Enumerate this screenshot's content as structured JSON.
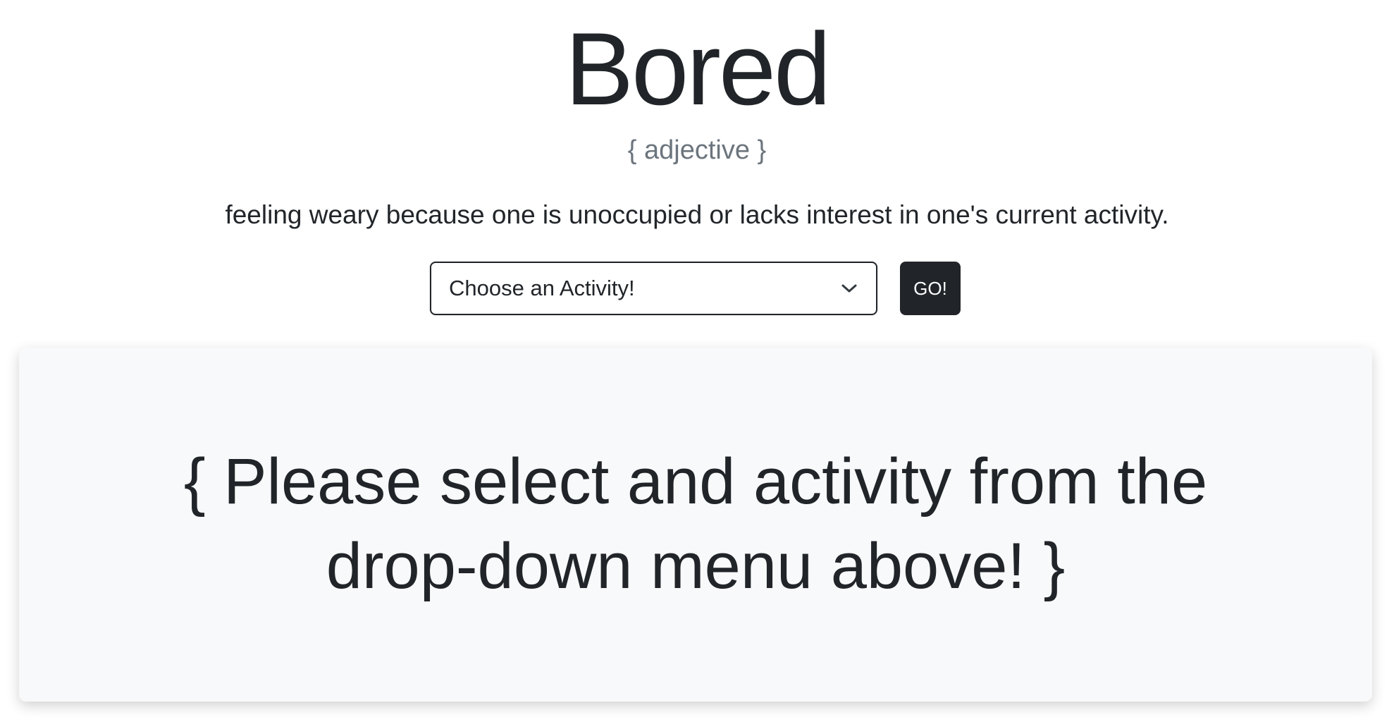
{
  "header": {
    "title": "Bored",
    "part_of_speech": "{ adjective }",
    "definition": "feeling weary because one is unoccupied or lacks interest in one's current activity."
  },
  "controls": {
    "activity_select": {
      "selected_label": "Choose an Activity!",
      "icon": "chevron-down-icon"
    },
    "go_label": "GO!"
  },
  "result_card": {
    "message": "{ Please select and activity from the drop-down menu above! }"
  },
  "colors": {
    "text": "#212529",
    "muted": "#6c757d",
    "card_bg": "#f8f9fa",
    "button_bg": "#212529"
  }
}
